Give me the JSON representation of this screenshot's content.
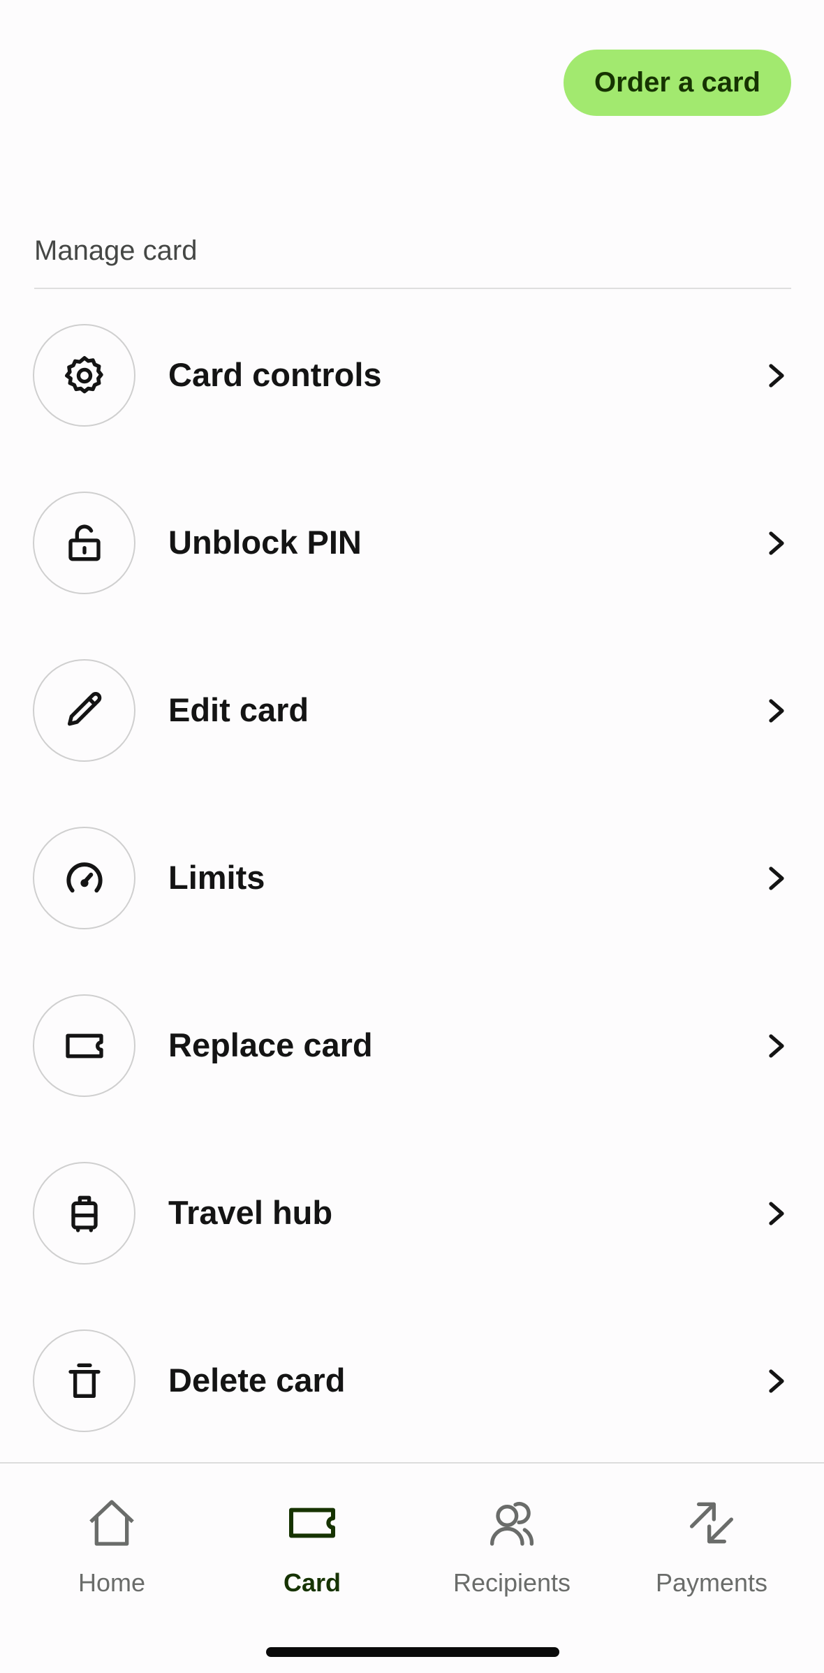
{
  "header": {
    "order_button_label": "Order a card"
  },
  "manage": {
    "section_title": "Manage card",
    "items": [
      {
        "label": "Card controls",
        "icon": "gear-icon"
      },
      {
        "label": "Unblock PIN",
        "icon": "unlock-icon"
      },
      {
        "label": "Edit card",
        "icon": "pencil-icon"
      },
      {
        "label": "Limits",
        "icon": "speedometer-icon"
      },
      {
        "label": "Replace card",
        "icon": "card-icon"
      },
      {
        "label": "Travel hub",
        "icon": "luggage-icon"
      },
      {
        "label": "Delete card",
        "icon": "trash-icon"
      }
    ]
  },
  "tabbar": {
    "tabs": [
      {
        "label": "Home",
        "icon": "home-icon",
        "active": false
      },
      {
        "label": "Card",
        "icon": "card-icon",
        "active": true
      },
      {
        "label": "Recipients",
        "icon": "people-icon",
        "active": false
      },
      {
        "label": "Payments",
        "icon": "transfer-arrows-icon",
        "active": false
      }
    ]
  },
  "colors": {
    "accent_green": "#a2e96f",
    "accent_dark": "#163300",
    "text_primary": "#141414",
    "text_secondary": "#6a6c6a"
  }
}
